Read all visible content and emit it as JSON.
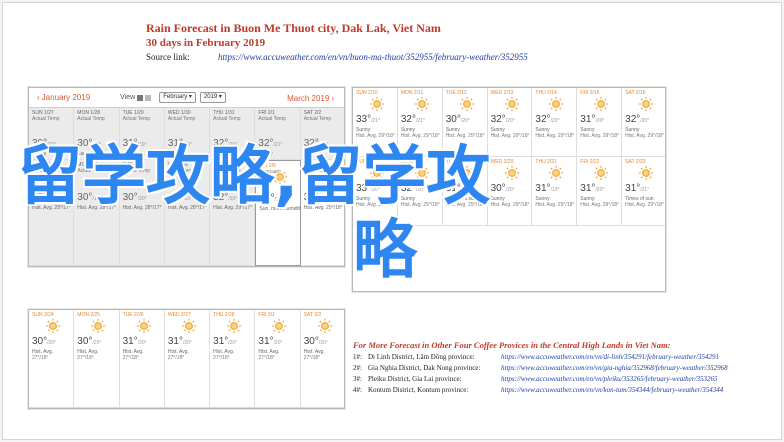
{
  "header": {
    "title": "Rain Forecast in Buon Me Thuot city, Dak Lak, Viet Nam",
    "subtitle": "30 days in February 2019",
    "source_label": "Source link:",
    "source_url": "https://www.accuweather.com/en/vn/buon-ma-thuot/352955/february-weather/352955"
  },
  "calendar_bar": {
    "prev_label": "January 2019",
    "view_label": "View",
    "month_select": "February",
    "year_select": "2019",
    "next_label": "March 2019"
  },
  "panel1": {
    "row1": [
      {
        "day": "SUN 1/27",
        "hist": "Actual Temp",
        "hi": "30°",
        "lo": "/20°",
        "desc": "Sunny"
      },
      {
        "day": "MON 1/28",
        "hist": "Actual Temp",
        "hi": "30°",
        "lo": "/19°",
        "desc": "Sunny"
      },
      {
        "day": "TUE 1/29",
        "hist": "Actual Temp",
        "hi": "31°",
        "lo": "/19°",
        "desc": "Sunny"
      },
      {
        "day": "WED 1/30",
        "hist": "Actual Temp",
        "hi": "31°",
        "lo": "/20°",
        "desc": "Sunny"
      },
      {
        "day": "THU 1/31",
        "hist": "Actual Temp",
        "hi": "32°",
        "lo": "/20°",
        "desc": "Sunny"
      },
      {
        "day": "FRI 2/1",
        "hist": "Actual Temp",
        "hi": "32°",
        "lo": "/21°",
        "desc": "Sunny"
      },
      {
        "day": "SAT 2/2",
        "hist": "Actual Temp",
        "hi": "32°",
        "lo": "/20°",
        "desc": "Sunny"
      }
    ],
    "row2": [
      {
        "day": "SUN 2/3",
        "hist": "Actual Temp",
        "hi": "29°",
        "lo": "/20°",
        "desc": "Hist. Avg. 28°/17°"
      },
      {
        "day": "MON 2/4",
        "hist": "Actual Temp",
        "hi": "30°",
        "lo": "/19°",
        "desc": "Hist. Avg. 28°/17°"
      },
      {
        "day": "TUE 2/5",
        "hist": "Actual Temp",
        "hi": "30°",
        "lo": "/20°",
        "desc": "Hist. Avg. 28°/17°"
      },
      {
        "day": "WED 2/6",
        "hist": "Actual Temp",
        "hi": "31°",
        "lo": "/20°",
        "desc": "Hist. Avg. 28°/17°"
      },
      {
        "day": "THU 2/7",
        "hist": "Actual Temp",
        "hi": "32°",
        "lo": "/19°",
        "desc": "Hist. Avg. 29°/17°"
      },
      {
        "day": "FRI 2/8",
        "hist": "Forecast",
        "hi": "35°",
        "lo": "/20°",
        "desc": "Sun, more humidity"
      },
      {
        "day": "SAT 2/9",
        "hist": "Forecast",
        "hi": "33°",
        "lo": "/21°",
        "desc": "Hist. Avg. 29°/18°"
      }
    ]
  },
  "panel2": {
    "row1": [
      {
        "day": "SUN 2/10",
        "hi": "33°",
        "lo": "/21°",
        "desc": "Sunny",
        "hist": "Hist. Avg. 29°/18°"
      },
      {
        "day": "MON 2/11",
        "hi": "32°",
        "lo": "/21°",
        "desc": "Sunny",
        "hist": "Hist. Avg. 29°/18°"
      },
      {
        "day": "TUE 2/12",
        "hi": "30°",
        "lo": "/20°",
        "desc": "Sunny",
        "hist": "Hist. Avg. 29°/18°"
      },
      {
        "day": "WED 2/13",
        "hi": "32°",
        "lo": "/20°",
        "desc": "Sunny",
        "hist": "Hist. Avg. 29°/18°"
      },
      {
        "day": "THU 2/14",
        "hi": "32°",
        "lo": "/20°",
        "desc": "Sunny",
        "hist": "Hist. Avg. 29°/18°"
      },
      {
        "day": "FRI 2/15",
        "hi": "31°",
        "lo": "/20°",
        "desc": "Sunny",
        "hist": "Hist. Avg. 29°/18°"
      },
      {
        "day": "SAT 2/16",
        "hi": "32°",
        "lo": "/20°",
        "desc": "Sunny",
        "hist": "Hist. Avg. 29°/18°"
      }
    ],
    "row2": [
      {
        "day": "SUN 2/17",
        "hi": "33°",
        "lo": "/20°",
        "desc": "Sunny",
        "hist": "Hist. Avg. 29°/18°"
      },
      {
        "day": "MON 2/18",
        "hi": "32°",
        "lo": "/20°",
        "desc": "Sunny",
        "hist": "Hist. Avg. 29°/18°"
      },
      {
        "day": "TUE 2/19",
        "hi": "31°",
        "lo": "/20°",
        "desc": "Abundant sunshine",
        "hist": "Hist. Avg. 29°/18°"
      },
      {
        "day": "WED 2/20",
        "hi": "30°",
        "lo": "/20°",
        "desc": "Sunny",
        "hist": "Hist. Avg. 29°/18°"
      },
      {
        "day": "THU 2/21",
        "hi": "31°",
        "lo": "/19°",
        "desc": "Sunny",
        "hist": "Hist. Avg. 29°/18°"
      },
      {
        "day": "FRI 2/22",
        "hi": "31°",
        "lo": "/20°",
        "desc": "Sunny",
        "hist": "Hist. Avg. 29°/18°"
      },
      {
        "day": "SAT 2/23",
        "hi": "31°",
        "lo": "/21°",
        "desc": "Times of sun",
        "hist": "Hist. Avg. 29°/18°"
      }
    ]
  },
  "panel3": {
    "row1": [
      {
        "day": "SUN 2/24",
        "hi": "30°",
        "lo": "/20°",
        "desc": "Hist. Avg.",
        "hist": "27°/18°"
      },
      {
        "day": "MON 2/25",
        "hi": "30°",
        "lo": "/20°",
        "desc": "Hist. Avg.",
        "hist": "27°/18°"
      },
      {
        "day": "TUE 2/26",
        "hi": "31°",
        "lo": "/20°",
        "desc": "Hist. Avg.",
        "hist": "27°/18°"
      },
      {
        "day": "WED 2/27",
        "hi": "31°",
        "lo": "/20°",
        "desc": "Hist. Avg.",
        "hist": "27°/18°"
      },
      {
        "day": "THU 2/28",
        "hi": "31°",
        "lo": "/20°",
        "desc": "Hist. Avg.",
        "hist": "27°/18°"
      },
      {
        "day": "FRI 3/1",
        "hi": "31°",
        "lo": "/20°",
        "desc": "Hist. Avg.",
        "hist": "27°/18°"
      },
      {
        "day": "SAT 3/2",
        "hi": "30°",
        "lo": "/20°",
        "desc": "Hist. Avg.",
        "hist": "27°/18°"
      }
    ]
  },
  "watermark": {
    "line1": "留学攻略,留学攻",
    "line2": "略"
  },
  "more_forecast": {
    "title": "For More Forecast in Other Four Coffee Provices in the Central High Lands in Viet Nam:",
    "rows": [
      {
        "num": "1#:",
        "name": "Di Linh District, Lâm Đồng province:",
        "url": "https://www.accuweather.com/en/vn/di-linh/354291/february-weather/354291"
      },
      {
        "num": "2#:",
        "name": "Gia Nghia District, Dak Nong province:",
        "url": "https://www.accuweather.com/en/vn/gia-nghia/352968/february-weather/352968"
      },
      {
        "num": "3#:",
        "name": "Pleiku District, Gia Lai province:",
        "url": "https://www.accuweather.com/en/vn/pleiku/353265/february-weather/353265"
      },
      {
        "num": "4#:",
        "name": "Kontum District, Kontum province:",
        "url": "https://www.accuweather.com/en/vn/kon-tum/354344/february-weather/354344"
      }
    ]
  },
  "colors": {
    "title_red": "#c0392b",
    "link_blue": "#1f3fa8",
    "sun_orange": "#f2a33a",
    "watermark_blue": "#2e86f0"
  }
}
